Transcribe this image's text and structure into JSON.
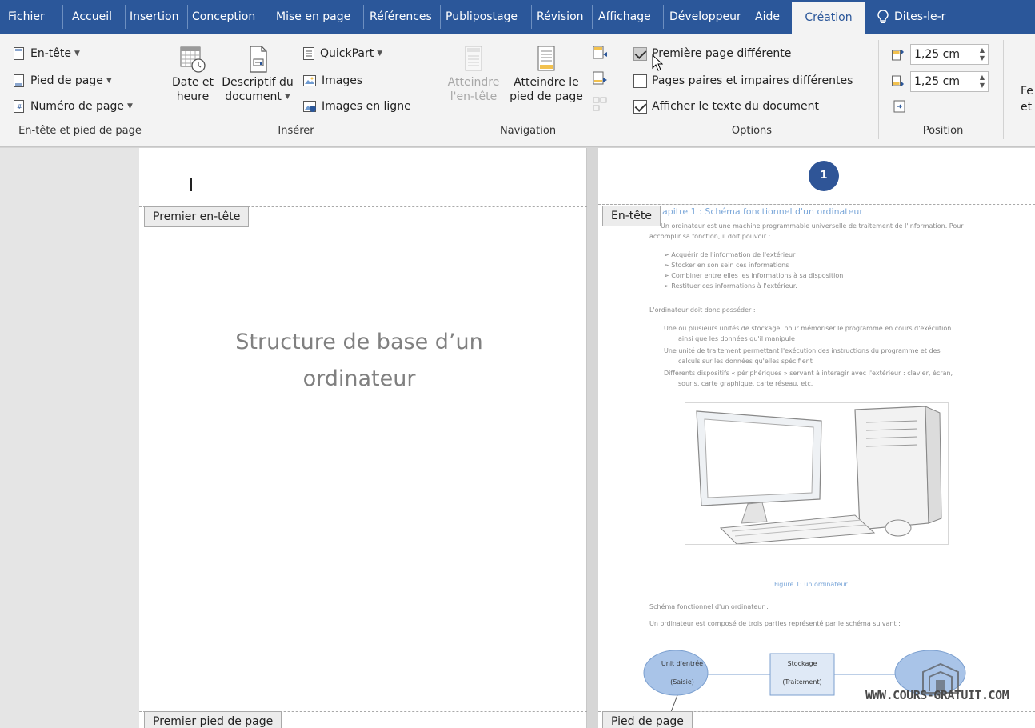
{
  "tabs": [
    {
      "label": "Fichier"
    },
    {
      "label": "Accueil"
    },
    {
      "label": "Insertion"
    },
    {
      "label": "Conception"
    },
    {
      "label": "Mise en page"
    },
    {
      "label": "Références"
    },
    {
      "label": "Publipostage"
    },
    {
      "label": "Révision"
    },
    {
      "label": "Affichage"
    },
    {
      "label": "Développeur"
    },
    {
      "label": "Aide"
    },
    {
      "label": "Création"
    }
  ],
  "tell_me": "Dites-le-r",
  "ribbon": {
    "group_header_footer": {
      "header_btn": "En-tête",
      "footer_btn": "Pied de page",
      "page_number_btn": "Numéro de page",
      "label": "En-tête et pied de page"
    },
    "group_insert": {
      "date_time_l1": "Date et",
      "date_time_l2": "heure",
      "doc_info_l1": "Descriptif du",
      "doc_info_l2": "document",
      "quickpart": "QuickPart",
      "images": "Images",
      "online_images": "Images en ligne",
      "label": "Insérer"
    },
    "group_navigation": {
      "goto_header_l1": "Atteindre",
      "goto_header_l2": "l'en-tête",
      "goto_footer_l1": "Atteindre le",
      "goto_footer_l2": "pied de page",
      "label": "Navigation"
    },
    "group_options": {
      "different_first": "Première page différente",
      "different_odd_even": "Pages paires et impaires différentes",
      "show_doc_text": "Afficher le texte du document",
      "label": "Options"
    },
    "group_position": {
      "header_from_top": "1,25 cm",
      "footer_from_bottom": "1,25 cm",
      "label": "Position"
    },
    "close_partial_l1": "Fe",
    "close_partial_l2": "et l"
  },
  "page1": {
    "first_header_tag": "Premier en-tête",
    "title": "Structure de base d’un ordinateur",
    "first_footer_tag": "Premier pied de page"
  },
  "page2": {
    "page_number": "1",
    "header_tag": "En-tête",
    "footer_tag": "Pied de page",
    "heading": "apitre 1 : Schéma fonctionnel d'un ordinateur",
    "intro_l1": "Un ordinateur est une machine programmable universelle de traitement de l'information. Pour",
    "intro_l2": "accomplir sa fonction, il doit pouvoir :",
    "list1": [
      "Acquérir de l'information de l'extérieur",
      "Stocker en son sein ces informations",
      "Combiner entre elles les informations à sa disposition",
      "Restituer ces informations à l'extérieur."
    ],
    "must_have": "L'ordinateur doit donc posséder :",
    "list2": [
      "Une ou plusieurs unités de stockage, pour mémoriser le programme en cours d'exécution",
      "ainsi que les données qu'il manipule",
      "Une unité de traitement permettant l'exécution des instructions du programme et des",
      "calculs sur les données qu'elles spécifient",
      "Différents dispositifs « périphériques » servant à interagir avec l'extérieur : clavier, écran,",
      "souris, carte graphique, carte réseau, etc."
    ],
    "figure_caption": "Figure 1: un ordinateur",
    "schema_title": "Schéma fonctionnel d'un ordinateur :",
    "schema_intro": "Un ordinateur est composé de trois parties représenté par le schéma suivant :",
    "diagram": {
      "left_l1": "Unit d'entrée",
      "left_l2": "(Saisie)",
      "middle_l1": "Stockage",
      "middle_l2": "(Traitement)"
    }
  },
  "watermark": "WWW.COURS-GRATUIT.COM",
  "colors": {
    "ribbon_blue": "#2b579a",
    "ribbon_bg": "#f3f3f3",
    "page_number_bg": "#2f5597",
    "link_blue": "#7ba7d9"
  }
}
